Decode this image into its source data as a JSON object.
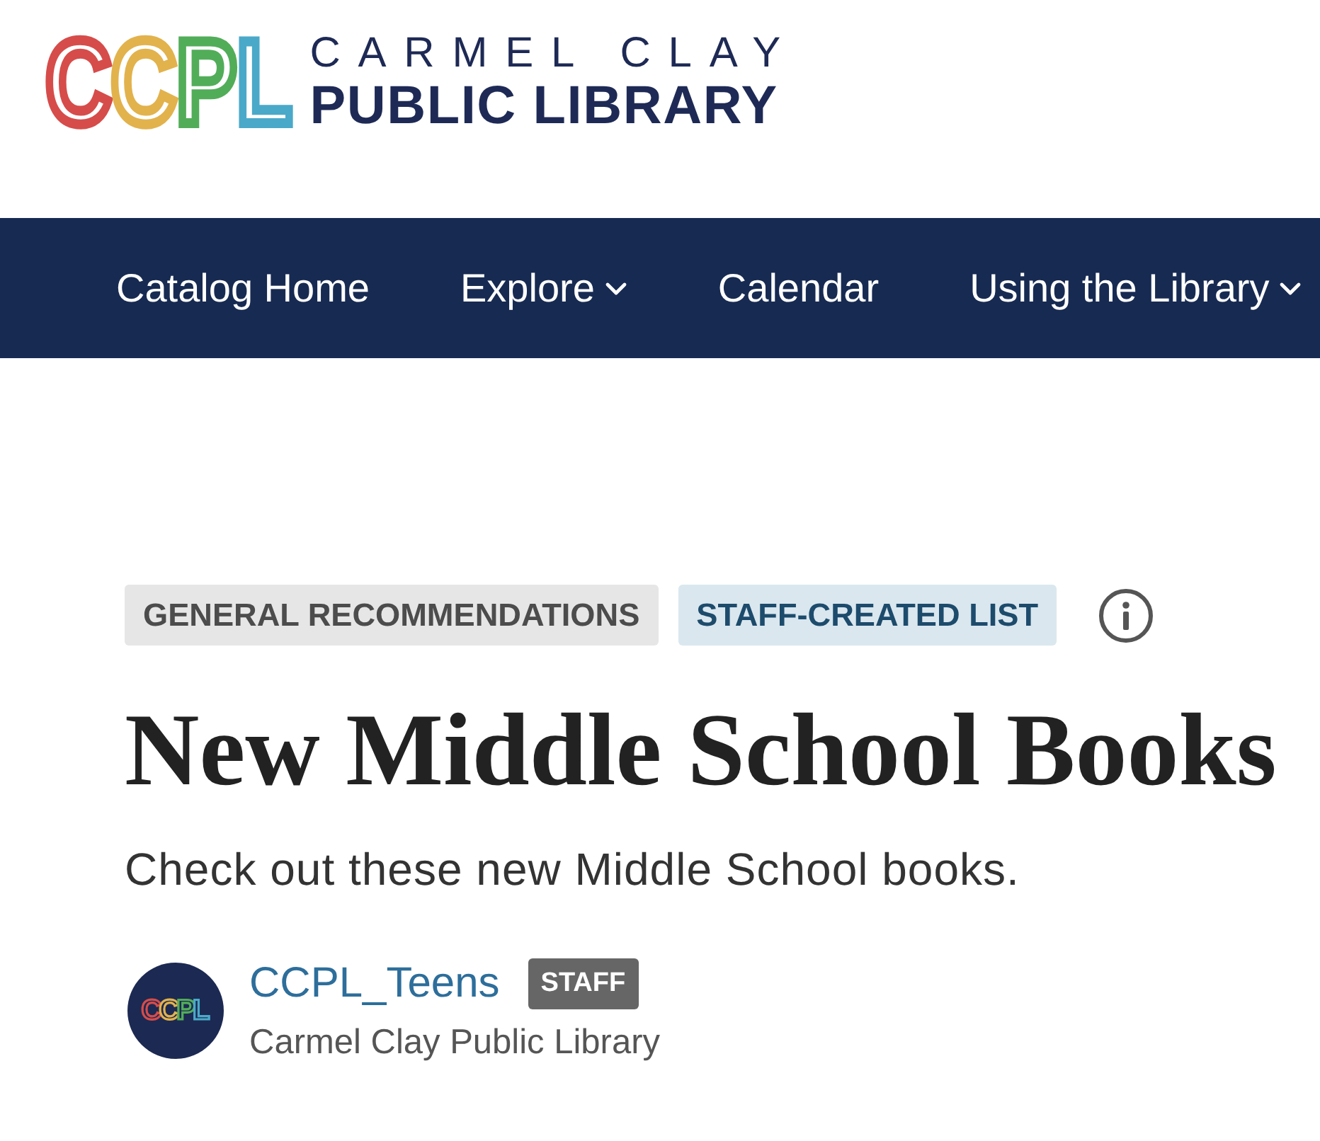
{
  "header": {
    "logo": {
      "mark": "CCPL",
      "line_1": "CARMEL CLAY",
      "line_2": "PUBLIC LIBRARY"
    }
  },
  "nav": {
    "items": [
      {
        "label": "Catalog Home",
        "has_menu": false
      },
      {
        "label": "Explore",
        "has_menu": true
      },
      {
        "label": "Calendar",
        "has_menu": false
      },
      {
        "label": "Using the Library",
        "has_menu": true
      }
    ]
  },
  "list": {
    "tags": [
      {
        "label": "GENERAL RECOMMENDATIONS",
        "kind": "category"
      },
      {
        "label": "STAFF-CREATED LIST",
        "kind": "list-type"
      }
    ],
    "title": "New Middle School Books",
    "description": "Check out these new Middle School books.",
    "author": {
      "avatar_mark": "CCPL",
      "name": "CCPL_Teens",
      "badge": "STAFF",
      "organization": "Carmel Clay Public Library"
    }
  }
}
